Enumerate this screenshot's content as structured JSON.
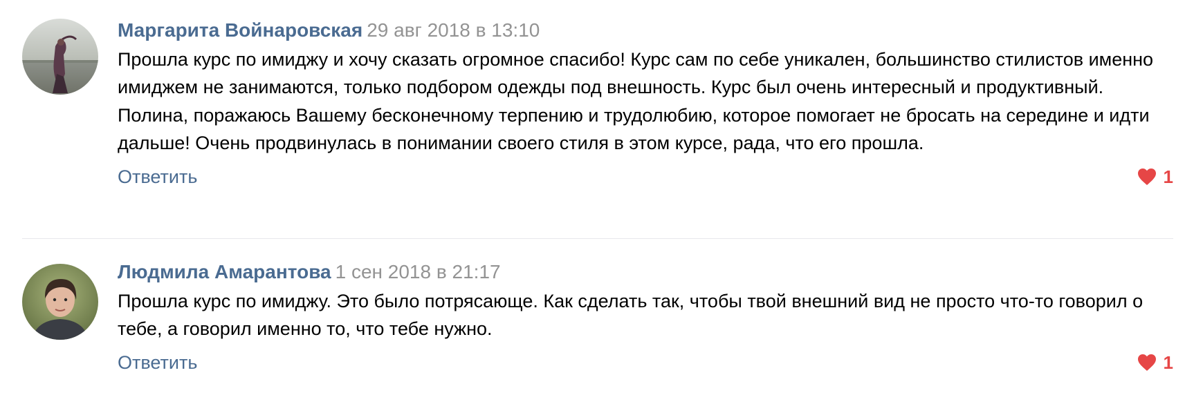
{
  "comments": [
    {
      "author": "Маргарита Войнаровская",
      "date": "29 авг 2018 в 13:10",
      "text": "Прошла курс по имиджу и хочу сказать огромное спасибо! Курс сам по себе уникален, большинство стилистов именно имиджем не занимаются, только подбором одежды под внешность. Курс был очень интересный и продуктивный. Полина, поражаюсь Вашему бесконечному терпению и трудолюбию, которое помогает не бросать на середине и идти дальше! Очень продвинулась в понимании своего стиля в этом курсе, рада, что его прошла.",
      "reply_label": "Ответить",
      "likes": "1"
    },
    {
      "author": "Людмила Амарантова",
      "date": "1 сен 2018 в 21:17",
      "text": "Прошла курс по имиджу. Это было потрясающе. Как сделать так, чтобы твой внешний вид не просто что-то говорил о тебе, а говорил именно то, что тебе нужно.",
      "reply_label": "Ответить",
      "likes": "1"
    }
  ],
  "colors": {
    "author_link": "#4a6b91",
    "date": "#939393",
    "like_heart": "#e64646",
    "divider": "#e7e8ec"
  },
  "icons": {
    "like": "heart-icon"
  }
}
